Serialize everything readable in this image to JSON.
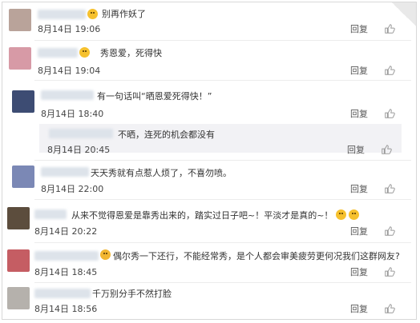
{
  "comments": [
    {
      "text": "别再作妖了",
      "time": "8月14日 19:06",
      "reply": "回复"
    },
    {
      "text": "秀恩爱，死得快",
      "time": "8月14日 19:04",
      "reply": "回复"
    },
    {
      "text": "有一句话叫“晒恩爱死得快！”",
      "time": "8月14日 18:40",
      "reply": "回复"
    },
    {
      "text": "不晒，连死的机会都没有",
      "time": "8月14日 20:45",
      "reply": "回复"
    },
    {
      "text": "天天秀就有点惹人烦了，不喜勿喷。",
      "time": "8月14日 22:00",
      "reply": "回复"
    },
    {
      "text": "从来不觉得恩爱是靠秀出来的，踏实过日子吧~！平淡才是真的~！",
      "time": "8月14日 20:22",
      "reply": "回复"
    },
    {
      "text": "偶尔秀一下还行，不能经常秀，是个人都会审美疲劳更何况我们这群网友?",
      "time": "8月14日 18:45",
      "reply": "回复"
    },
    {
      "text": "千万别分手不然打脸",
      "time": "8月14日 18:56",
      "reply": "回复"
    }
  ],
  "colors": {
    "avatar_1": "#b9a39a",
    "avatar_2": "#d79aa6",
    "avatar_3": "#3d4c73",
    "avatar_5": "#7b88b5",
    "avatar_6": "#5c4d3d",
    "avatar_7": "#c55d63",
    "avatar_8": "#b5b1ac"
  },
  "icons": [
    "thumbs-up-icon",
    "emoji-icon"
  ]
}
